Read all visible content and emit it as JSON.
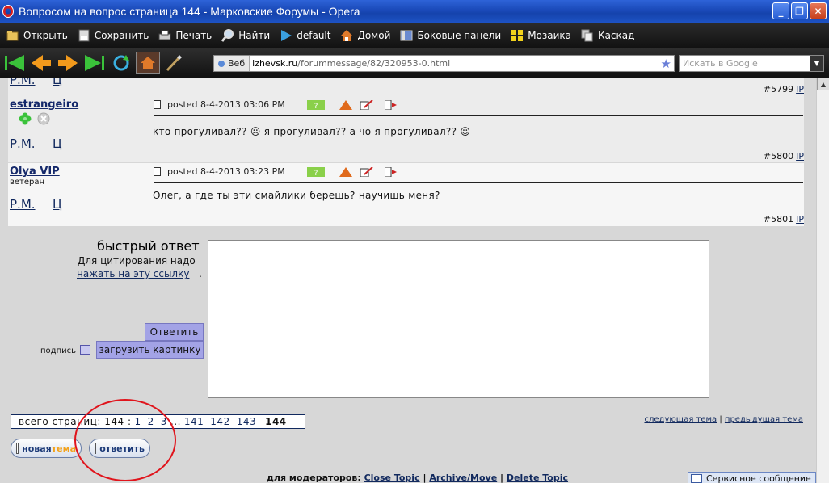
{
  "window": {
    "title": "Вопросом на вопрос страница 144 - Марковские Форумы - Opera"
  },
  "menu": {
    "items": [
      {
        "label": "Открыть",
        "icon": "folder-open-icon"
      },
      {
        "label": "Сохранить",
        "icon": "save-icon"
      },
      {
        "label": "Печать",
        "icon": "printer-icon"
      },
      {
        "label": "Найти",
        "icon": "magnifier-icon"
      },
      {
        "label": "default",
        "icon": "play-arrow-icon"
      },
      {
        "label": "Домой",
        "icon": "home-icon"
      },
      {
        "label": "Боковые панели",
        "icon": "panels-icon"
      },
      {
        "label": "Мозаика",
        "icon": "tile-icon"
      },
      {
        "label": "Каскад",
        "icon": "cascade-icon"
      }
    ]
  },
  "nav": {
    "web_label": "Веб",
    "url_host": "izhevsk.ru",
    "url_path": "/forummessage/82/320953-0.html",
    "search_placeholder": "Искать в Google"
  },
  "top_fragment": {
    "rm": "Р.М.",
    "ts": "Ц",
    "post_number": "#5799",
    "ip": "IP"
  },
  "posts": [
    {
      "author": "estrangeiro",
      "posted": "posted 8-4-2013 03:06 PM",
      "text": "кто прогуливал?? ☹ я прогуливал?? а чо я прогуливал?? ☺",
      "rm": "Р.М.",
      "ts": "Ц",
      "post_number": "#5800",
      "ip": "IP"
    },
    {
      "author": "Olya VIP",
      "rank": "ветеран",
      "posted": "posted 8-4-2013 03:23 PM",
      "text": "Олег, а где ты эти смайлики берешь? научишь меня?",
      "rm": "Р.М.",
      "ts": "Ц",
      "post_number": "#5801",
      "ip": "IP"
    }
  ],
  "quick_reply": {
    "title": "быстрый ответ",
    "hint": "Для цитирования надо",
    "link": "нажать на эту ссылку",
    "link_suffix": ".",
    "reply_button": "Ответить",
    "signature_label": "подпись",
    "upload_button": "загрузить картинку"
  },
  "pagination": {
    "prefix": "всего страниц: 144 :",
    "pages": [
      "1",
      "2",
      "3"
    ],
    "ellipsis": "...",
    "pages_tail": [
      "141",
      "142",
      "143"
    ],
    "current": "144"
  },
  "topic_nav": {
    "next": "следующая тема",
    "separator": "|",
    "prev": "предыдущая тема"
  },
  "buttons": {
    "new_topic_main": "новая ",
    "new_topic_accent": "тема",
    "reply": "ответить"
  },
  "moderators": {
    "label": "для модераторов:",
    "close": "Close Topic",
    "archive": "Archive/Move",
    "delete": "Delete Topic",
    "sep": "|"
  },
  "service_message": "Сервисное сообщение",
  "colors": {
    "annotation": "#e0141c",
    "link": "#11295e",
    "button_purple": "#a3a3e6"
  }
}
